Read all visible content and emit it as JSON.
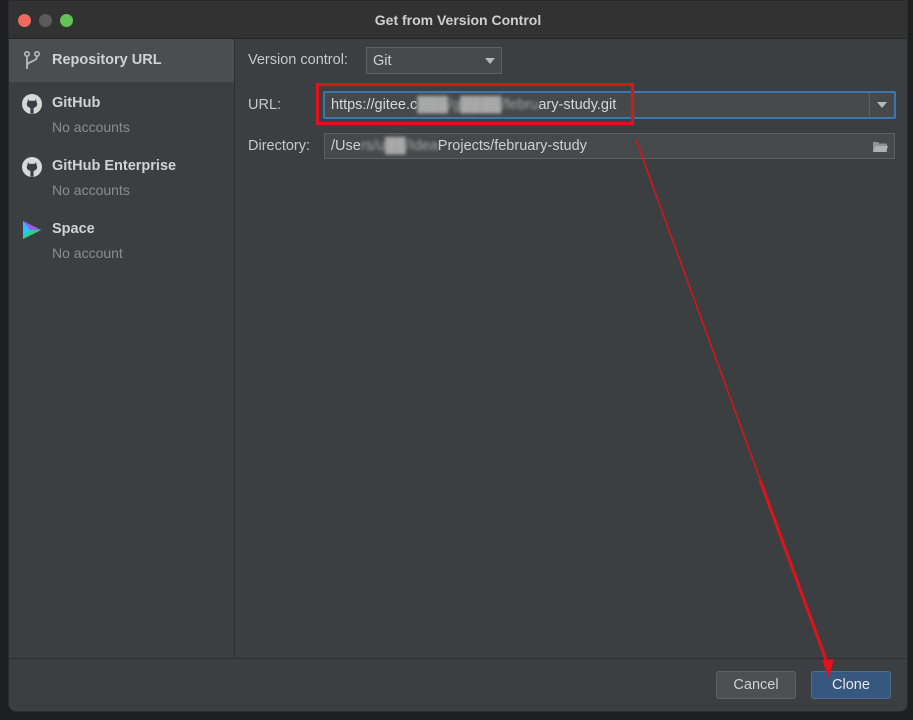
{
  "window": {
    "title": "Get from Version Control"
  },
  "sidebar": {
    "items": [
      {
        "name": "Repository URL",
        "sub": ""
      },
      {
        "name": "GitHub",
        "sub": "No accounts"
      },
      {
        "name": "GitHub Enterprise",
        "sub": "No accounts"
      },
      {
        "name": "Space",
        "sub": "No account"
      }
    ]
  },
  "form": {
    "version_control_label": "Version control:",
    "version_control_value": "Git",
    "url_label": "URL:",
    "url_value_start": "https://gitee.c",
    "url_value_end": "ary-study.git",
    "directory_label": "Directory:",
    "directory_value_start": "/Use",
    "directory_value_end": "Projects/february-study"
  },
  "footer": {
    "cancel_label": "Cancel",
    "clone_label": "Clone"
  },
  "colors": {
    "annotation_red": "#e0121a",
    "accent_blue": "#365880",
    "focus_blue": "#3d75ad"
  }
}
